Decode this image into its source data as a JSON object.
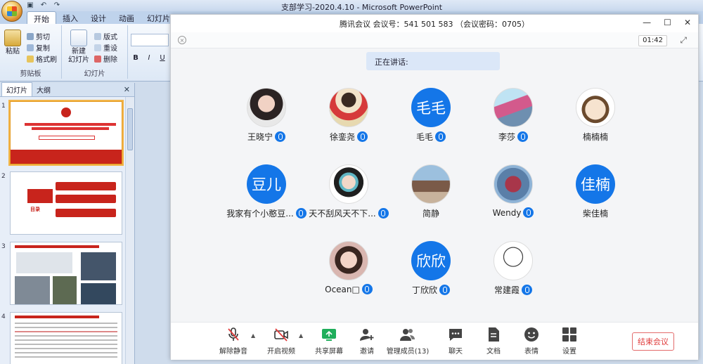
{
  "powerpoint": {
    "window_title": "支部学习-2020.4.10 - Microsoft PowerPoint",
    "tabs": [
      "开始",
      "插入",
      "设计",
      "动画",
      "幻灯片放"
    ],
    "active_tab": "开始",
    "clipboard": {
      "paste": "粘贴",
      "cut": "剪切",
      "copy": "复制",
      "format_painter": "格式刷",
      "group_label": "剪贴板"
    },
    "slides_group": {
      "new_slide": "新建\n幻灯片",
      "layout": "版式",
      "reset": "重设",
      "delete": "删除",
      "group_label": "幻灯片"
    },
    "font_buttons": [
      "B",
      "I",
      "U"
    ],
    "panel_tabs": [
      "幻灯片",
      "大纲"
    ],
    "slide_numbers": [
      "1",
      "2",
      "3",
      "4"
    ],
    "slide2_label": "目录"
  },
  "meeting": {
    "title": "腾讯会议  会议号：541 501 583  （会议密码：0705）",
    "timer": "01:42",
    "speaking_label": "正在讲话:",
    "participants": [
      {
        "name": "王晓宁",
        "avatar_type": "photo",
        "avatar_desc": "girl-photo"
      },
      {
        "name": "徐銮尧",
        "avatar_type": "photo",
        "avatar_desc": "fan-cartoon"
      },
      {
        "name": "毛毛",
        "avatar_type": "text",
        "avatar_text": "毛毛"
      },
      {
        "name": "李莎",
        "avatar_type": "photo",
        "avatar_desc": "child-photo"
      },
      {
        "name": "楠楠楠",
        "avatar_type": "photo",
        "avatar_desc": "cartoon-face"
      },
      {
        "name": "豆儿",
        "avatar_type": "text",
        "avatar_text": "豆儿",
        "display_name": "我家有个小憨豆..."
      },
      {
        "name": "天不刮风天不下...",
        "avatar_type": "photo",
        "avatar_desc": "masked-cartoon"
      },
      {
        "name": "简静",
        "avatar_type": "photo",
        "avatar_desc": "street-photo"
      },
      {
        "name": "Wendy",
        "avatar_type": "photo",
        "avatar_desc": "tree-photo"
      },
      {
        "name": "柴佳楠",
        "avatar_type": "text",
        "avatar_text": "佳楠"
      },
      {
        "name": "Ocean□",
        "avatar_type": "photo",
        "avatar_desc": "baby-photo"
      },
      {
        "name": "丁欣欣",
        "avatar_type": "text",
        "avatar_text": "欣欣"
      },
      {
        "name": "常建霞",
        "avatar_type": "photo",
        "avatar_desc": "sketch-cartoon"
      }
    ],
    "toolbar": {
      "unmute": "解除静音",
      "start_video": "开启视频",
      "share_screen": "共享屏幕",
      "invite": "邀请",
      "manage_members": "管理成员(13)",
      "chat": "聊天",
      "documents": "文档",
      "reactions": "表情",
      "settings": "设置",
      "end_meeting": "结束会议"
    },
    "colors": {
      "accent": "#1476e8",
      "end_red": "#e03c3c",
      "share_green": "#1fae5b"
    }
  }
}
